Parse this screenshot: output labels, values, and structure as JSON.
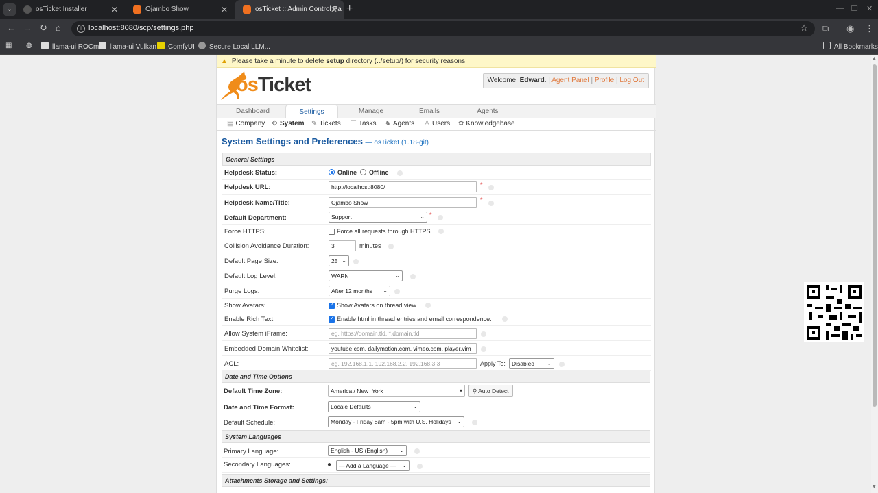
{
  "browser": {
    "tabs": [
      {
        "title": "osTicket Installer",
        "active": false
      },
      {
        "title": "Ojambo Show",
        "active": false
      },
      {
        "title": "osTicket :: Admin Control Pa",
        "active": true
      }
    ],
    "url": "localhost:8080/scp/settings.php",
    "bookmarks": [
      "llama-ui ROCm",
      "llama-ui Vulkan",
      "ComfyUI",
      "Secure Local LLM..."
    ],
    "all_bookmarks": "All Bookmarks"
  },
  "notice": {
    "before": "Please take a minute to delete ",
    "bold": "setup",
    "after": " directory (../setup/) for security reasons."
  },
  "logo": {
    "part1": "os",
    "part2": "Ticket"
  },
  "userbar": {
    "welcome": "Welcome, ",
    "name": "Edward",
    "dot": ".",
    "agent_panel": "Agent Panel",
    "profile": "Profile",
    "logout": "Log Out",
    "sep": "|"
  },
  "nav": {
    "tabs": [
      "Dashboard",
      "Settings",
      "Manage",
      "Emails",
      "Agents"
    ]
  },
  "subnav": [
    "Company",
    "System",
    "Tickets",
    "Tasks",
    "Agents",
    "Users",
    "Knowledgebase"
  ],
  "page": {
    "title": "System Settings and Preferences",
    "version": "— osTicket (1.18-git)"
  },
  "general": {
    "section": "General Settings",
    "helpdesk_status": {
      "label": "Helpdesk Status:",
      "online": "Online",
      "offline": "Offline"
    },
    "helpdesk_url": {
      "label": "Helpdesk URL:",
      "value": "http://localhost:8080/"
    },
    "helpdesk_name": {
      "label": "Helpdesk Name/Title:",
      "value": "Ojambo Show"
    },
    "default_department": {
      "label": "Default Department:",
      "value": "Support"
    },
    "force_https": {
      "label": "Force HTTPS:",
      "text": "Force all requests through HTTPS."
    },
    "collision": {
      "label": "Collision Avoidance Duration:",
      "value": "3",
      "unit": "minutes"
    },
    "page_size": {
      "label": "Default Page Size:",
      "value": "25"
    },
    "log_level": {
      "label": "Default Log Level:",
      "value": "WARN"
    },
    "purge_logs": {
      "label": "Purge Logs:",
      "value": "After 12 months"
    },
    "avatars": {
      "label": "Show Avatars:",
      "text": "Show Avatars on thread view."
    },
    "rich_text": {
      "label": "Enable Rich Text:",
      "text": "Enable html in thread entries and email correspondence."
    },
    "iframe": {
      "label": "Allow System iFrame:",
      "placeholder": "eg. https://domain.tld, *.domain.tld"
    },
    "whitelist": {
      "label": "Embedded Domain Whitelist:",
      "value": "youtube.com, dailymotion.com, vimeo.com, player.vim"
    },
    "acl": {
      "label": "ACL:",
      "placeholder": "eg. 192.168.1.1, 192.168.2.2, 192.168.3.3",
      "apply_to": "Apply To:",
      "apply_value": "Disabled"
    }
  },
  "datetime": {
    "section": "Date and Time Options",
    "timezone": {
      "label": "Default Time Zone:",
      "value": "America / New_York",
      "button": "Auto Detect"
    },
    "format": {
      "label": "Date and Time Format:",
      "value": "Locale Defaults"
    },
    "schedule": {
      "label": "Default Schedule:",
      "value": "Monday - Friday 8am - 5pm with U.S. Holidays"
    }
  },
  "languages": {
    "section": "System Languages",
    "primary": {
      "label": "Primary Language:",
      "value": "English - US (English)"
    },
    "secondary": {
      "label": "Secondary Languages:",
      "value": "— Add a Language —"
    }
  },
  "attachments": {
    "section": "Attachments Storage and Settings:"
  }
}
